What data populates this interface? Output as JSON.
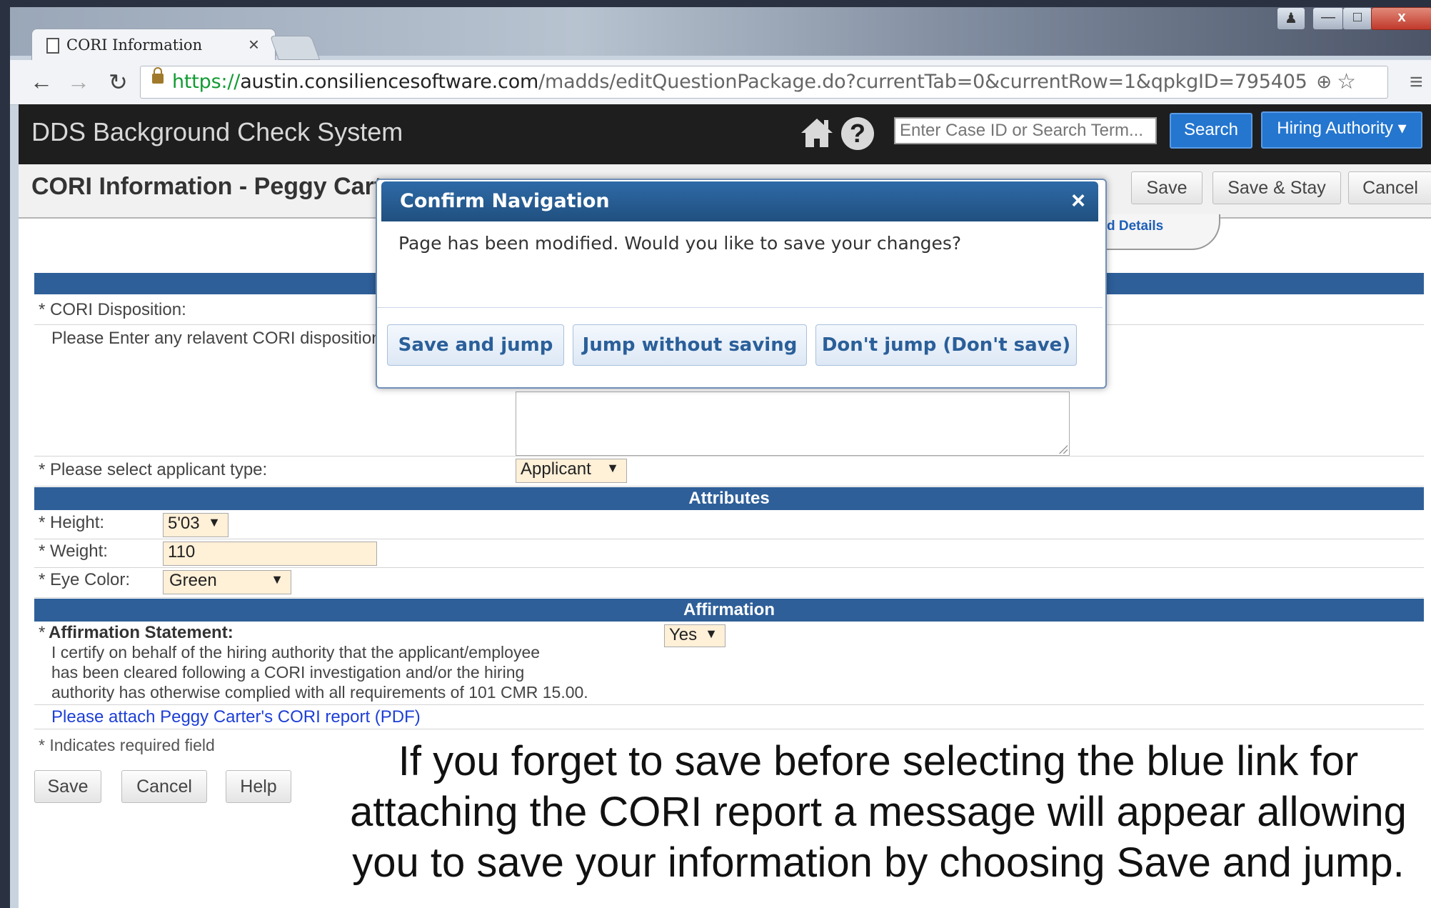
{
  "browser": {
    "tab_title": "CORI Information",
    "tab_close": "×",
    "url_scheme": "https://",
    "url_host": "austin.consiliencesoftware.com",
    "url_path": "/madds/editQuestionPackage.do?currentTab=0&currentRow=1&qpkgID=795405",
    "window_close": "x"
  },
  "app": {
    "title": "DDS Background Check System",
    "search_placeholder": "Enter Case ID or Search Term...",
    "search_label": "Search",
    "authority_label": "Hiring Authority ▾"
  },
  "header": {
    "page_title": "CORI Information - Peggy Carter",
    "save": "Save",
    "save_stay": "Save & Stay",
    "cancel": "Cancel",
    "details_link": "d Details"
  },
  "form": {
    "disposition_label": "* CORI Disposition:",
    "disposition_help": "Please Enter any relavent CORI disposition",
    "applicant_type_label": "* Please select applicant type:",
    "applicant_type_value": "Applicant",
    "attributes_header": "Attributes",
    "height_label": "* Height:",
    "height_value": "5'03",
    "weight_label": "* Weight:",
    "weight_value": "110",
    "eye_label": "* Eye Color:",
    "eye_value": "Green",
    "affirmation_header": "Affirmation",
    "affirmation_star": "*",
    "affirmation_label": "Affirmation Statement:",
    "affirmation_value": "Yes",
    "affirmation_text_1": "I certify on behalf of the hiring authority that the applicant/employee",
    "affirmation_text_2": "has been cleared following a CORI investigation and/or the hiring",
    "affirmation_text_3": "authority has otherwise complied with all requirements of 101 CMR 15.00.",
    "attach_link": "Please attach Peggy Carter's CORI report (PDF)",
    "required_note": "* Indicates required field",
    "save": "Save",
    "cancel": "Cancel",
    "help": "Help"
  },
  "modal": {
    "title": "Confirm Navigation",
    "close": "×",
    "message": "Page has been modified. Would you like to save your changes?",
    "save_jump": "Save and jump",
    "jump_nosave": "Jump without saving",
    "dont_jump": "Don't jump (Don't save)"
  },
  "caption": {
    "line1": "If you forget to save before selecting the blue link for",
    "line2": "attaching the CORI report a message will appear allowing",
    "line3": "you to save your information by choosing Save and jump."
  }
}
